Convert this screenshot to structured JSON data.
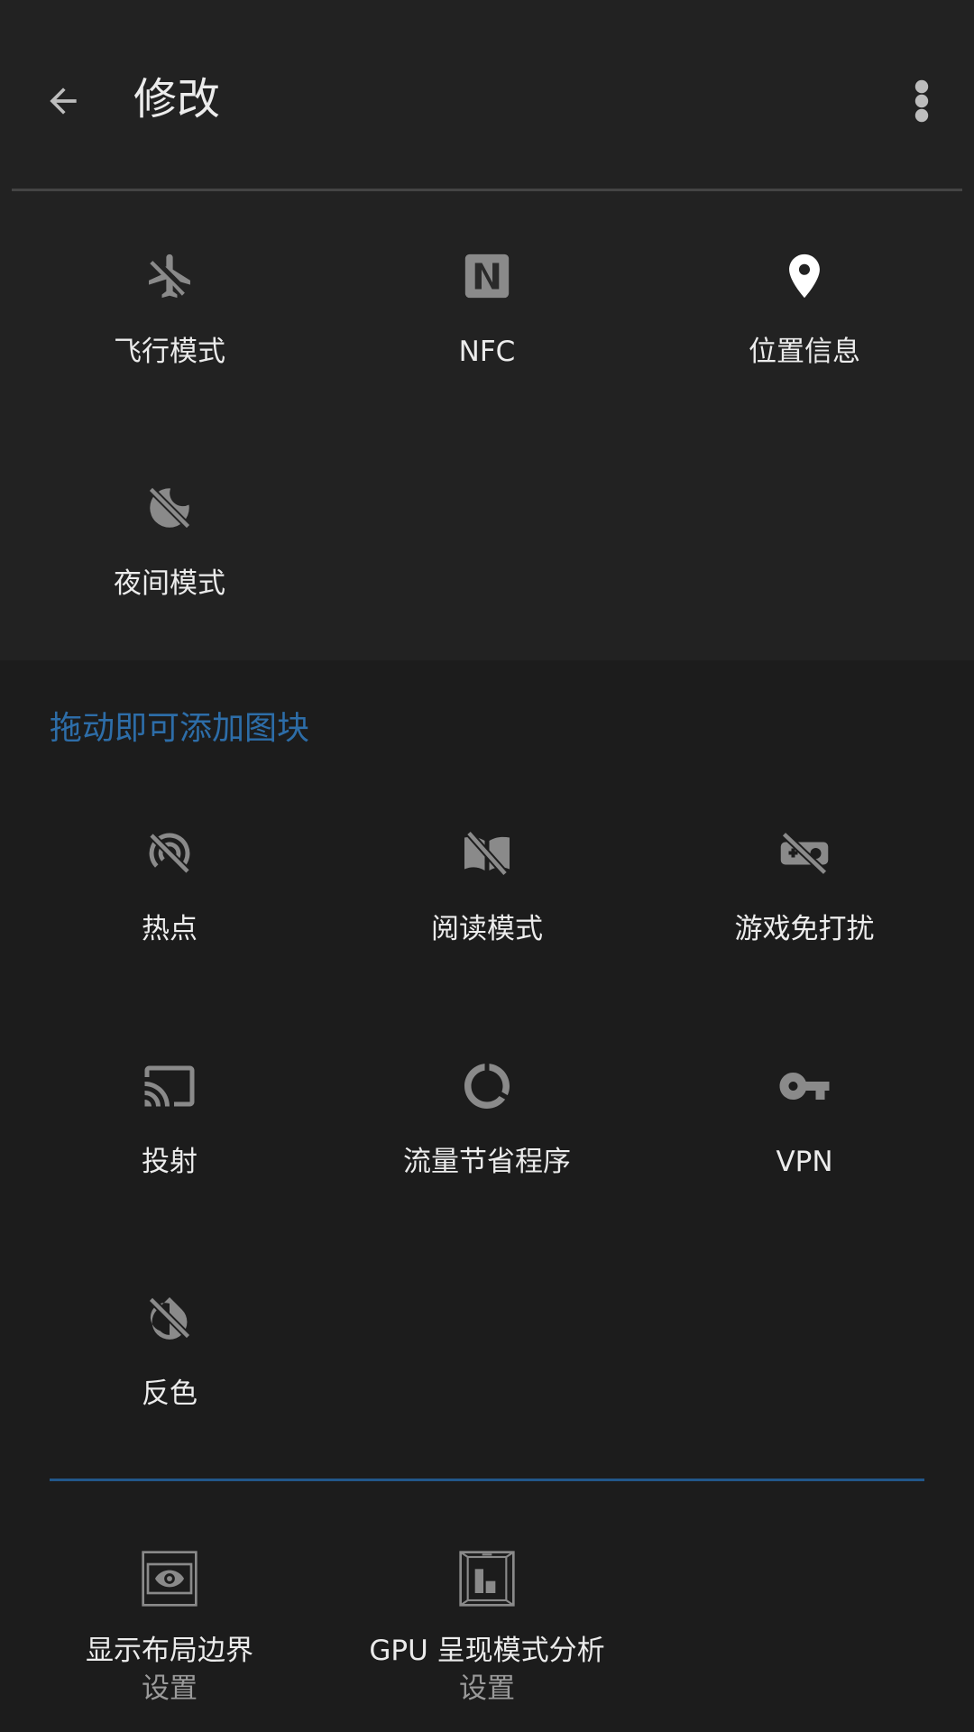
{
  "appbar": {
    "title": "修改",
    "back_icon": "arrow-back-icon",
    "menu_icon": "more-vert-icon"
  },
  "current_tiles": [
    {
      "label": "飞行模式",
      "icon": "airplane-off-icon",
      "active": false
    },
    {
      "label": "NFC",
      "icon": "nfc-icon",
      "active": false
    },
    {
      "label": "位置信息",
      "icon": "location-pin-icon",
      "active": true
    },
    {
      "label": "夜间模式",
      "icon": "night-mode-off-icon",
      "active": false
    }
  ],
  "available_header": "拖动即可添加图块",
  "available_tiles": [
    {
      "label": "热点",
      "icon": "hotspot-off-icon"
    },
    {
      "label": "阅读模式",
      "icon": "reading-mode-off-icon"
    },
    {
      "label": "游戏免打扰",
      "icon": "game-mode-off-icon"
    },
    {
      "label": "投射",
      "icon": "cast-icon"
    },
    {
      "label": "流量节省程序",
      "icon": "data-saver-icon"
    },
    {
      "label": "VPN",
      "icon": "vpn-key-icon"
    },
    {
      "label": "反色",
      "icon": "invert-colors-off-icon"
    }
  ],
  "developer_tiles": [
    {
      "label": "显示布局边界",
      "sublabel": "设置",
      "icon": "layout-bounds-icon"
    },
    {
      "label": "GPU 呈现模式分析",
      "sublabel": "设置",
      "icon": "gpu-profiling-icon"
    }
  ],
  "colors": {
    "accent": "#2d6da8",
    "divider_accent": "#22578a",
    "icon_inactive": "#8a8a8a",
    "icon_active": "#ffffff",
    "background": "#1c1c1c",
    "surface": "#222222"
  }
}
